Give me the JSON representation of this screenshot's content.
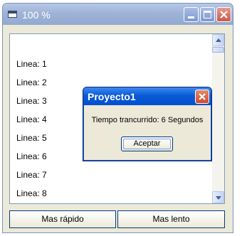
{
  "window": {
    "title": "100 %",
    "icons": {
      "app": "window-app-icon",
      "minimize": "minimize-icon",
      "maximize": "maximize-icon",
      "close": "close-icon"
    }
  },
  "list": {
    "items": [
      "Linea: 1",
      "Linea: 2",
      "Linea: 3",
      "Linea: 4",
      "Linea: 5",
      "Linea: 6",
      "Linea: 7",
      "Linea: 8"
    ]
  },
  "buttons": {
    "faster_label": "Mas rápido",
    "slower_label": "Mas lento"
  },
  "dialog": {
    "title": "Proyecto1",
    "message": "Tiempo trancurrido: 6 Segundos",
    "ok_label": "Aceptar"
  }
}
